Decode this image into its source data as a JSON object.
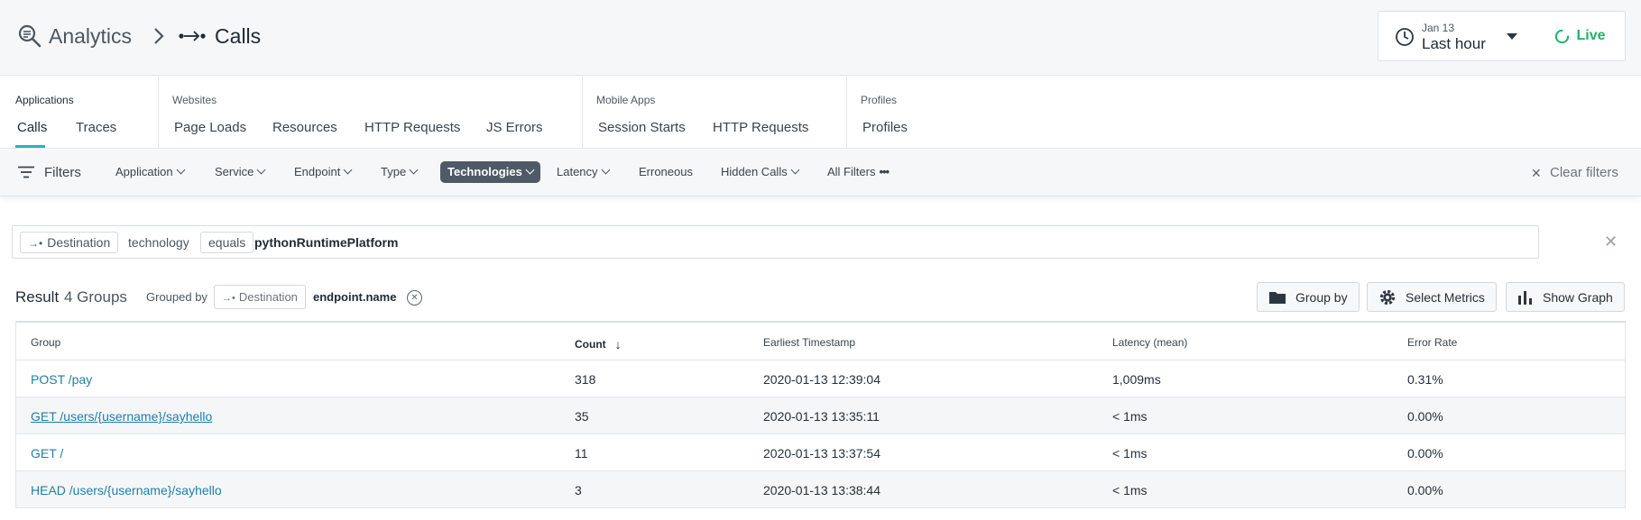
{
  "header": {
    "breadcrumb_root": "Analytics",
    "breadcrumb_current": "Calls",
    "time_date": "Jan 13",
    "time_range": "Last hour",
    "live_label": "Live",
    "live_color": "#1db56a"
  },
  "nav": {
    "sections": [
      {
        "heading": "Applications",
        "items": [
          "Calls",
          "Traces"
        ],
        "active": "Calls"
      },
      {
        "heading": "Websites",
        "items": [
          "Page Loads",
          "Resources",
          "HTTP Requests",
          "JS Errors"
        ]
      },
      {
        "heading": "Mobile Apps",
        "items": [
          "Session Starts",
          "HTTP Requests"
        ]
      },
      {
        "heading": "Profiles",
        "items": [
          "Profiles"
        ]
      }
    ],
    "accent_color": "#21b5c7"
  },
  "filters": {
    "label": "Filters",
    "items": [
      "Application",
      "Service",
      "Endpoint",
      "Type",
      "Technologies",
      "Latency",
      "Erroneous",
      "Hidden Calls",
      "All Filters"
    ],
    "active": "Technologies",
    "clear_label": "Clear filters"
  },
  "query": {
    "source_tag": "Destination",
    "key": "technology",
    "operator": "equals",
    "value": "pythonRuntimePlatform"
  },
  "result": {
    "label": "Result",
    "count": "4 Groups",
    "grouped_by_label": "Grouped by",
    "group_source_tag": "Destination",
    "group_field": "endpoint.name",
    "buttons": {
      "group_by": "Group by",
      "select_metrics": "Select Metrics",
      "show_graph": "Show Graph"
    }
  },
  "table": {
    "columns": [
      "Group",
      "Count",
      "Earliest Timestamp",
      "Latency (mean)",
      "Error Rate"
    ],
    "sorted_column": "Count",
    "rows": [
      [
        "POST /pay",
        "318",
        "2020-01-13 12:39:04",
        "1,009ms",
        "0.31%"
      ],
      [
        "GET /users/{username}/sayhello",
        "35",
        "2020-01-13 13:35:11",
        "< 1ms",
        "0.00%"
      ],
      [
        "GET /",
        "11",
        "2020-01-13 13:37:54",
        "< 1ms",
        "0.00%"
      ],
      [
        "HEAD /users/{username}/sayhello",
        "3",
        "2020-01-13 13:38:44",
        "< 1ms",
        "0.00%"
      ]
    ],
    "link_color": "#1f7fa8"
  }
}
